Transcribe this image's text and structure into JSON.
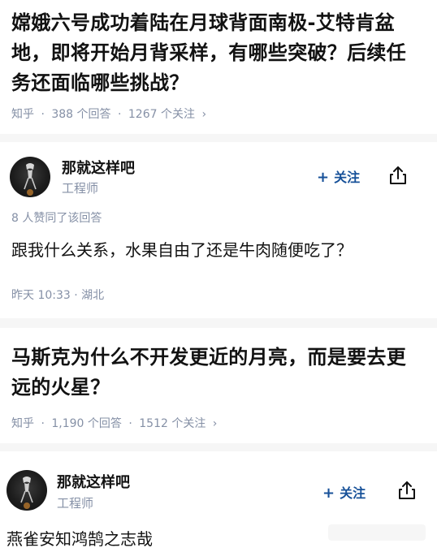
{
  "cards": [
    {
      "question": {
        "title": "嫦娥六号成功着陆在月球背面南极-艾特肯盆地，即将开始月背采样，有哪些突破？后续任务还面临哪些挑战？",
        "source": "知乎",
        "answers": "388 个回答",
        "followers": "1267 个关注",
        "chevron": "›"
      },
      "answer": {
        "author_name": "那就这样吧",
        "author_title": "工程师",
        "follow_label": "关注",
        "follow_icon": "plus-icon",
        "share_icon": "share-icon",
        "agree_text": "8 人赞同了该回答",
        "body": "跟我什么关系，水果自由了还是牛肉随便吃了？",
        "time": "昨天 10:33 · 湖北"
      }
    },
    {
      "question": {
        "title": "马斯克为什么不开发更近的月亮，而是要去更远的火星？",
        "source": "知乎",
        "answers": "1,190 个回答",
        "followers": "1512 个关注",
        "chevron": "›"
      },
      "answer": {
        "author_name": "那就这样吧",
        "author_title": "工程师",
        "follow_label": "关注",
        "follow_icon": "plus-icon",
        "share_icon": "share-icon",
        "body": "燕雀安知鸿鹄之志哉"
      }
    }
  ],
  "colors": {
    "text_primary": "#121212",
    "text_secondary": "#8590a6",
    "accent": "#175199",
    "separator": "#f6f6f6"
  }
}
